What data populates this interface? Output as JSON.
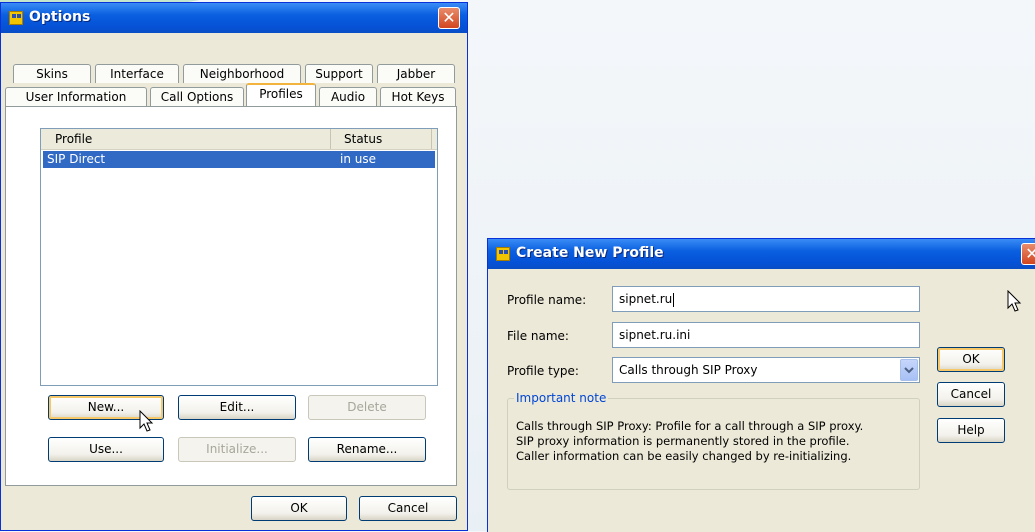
{
  "options_dialog": {
    "title": "Options",
    "tabs_row1": [
      "Skins",
      "Interface",
      "Neighborhood",
      "Support",
      "Jabber"
    ],
    "tabs_row2": [
      "User Information",
      "Call Options",
      "Profiles",
      "Audio",
      "Hot Keys"
    ],
    "active_tab": "Profiles",
    "table": {
      "columns": [
        "Profile",
        "Status"
      ],
      "rows": [
        {
          "profile": "SIP Direct",
          "status": "in use"
        }
      ]
    },
    "buttons": {
      "new": "New...",
      "edit": "Edit...",
      "delete": "Delete",
      "use": "Use...",
      "initialize": "Initialize...",
      "rename": "Rename...",
      "ok": "OK",
      "cancel": "Cancel"
    }
  },
  "create_dialog": {
    "title": "Create New Profile",
    "fields": {
      "profile_name_label": "Profile name:",
      "profile_name_value": "sipnet.ru",
      "file_name_label": "File name:",
      "file_name_value": "sipnet.ru.ini",
      "profile_type_label": "Profile type:",
      "profile_type_value": "Calls through SIP Proxy"
    },
    "note": {
      "legend": "Important note",
      "lines": [
        "Calls through SIP Proxy: Profile for a call through a SIP proxy.",
        "SIP proxy information is permanently stored in the profile.",
        "Caller information can be easily changed by re-initializing."
      ]
    },
    "buttons": {
      "ok": "OK",
      "cancel": "Cancel",
      "help": "Help"
    }
  },
  "colors": {
    "titlebar": "#0551d6",
    "selection": "#316ac5",
    "dialog_bg": "#ece9d8",
    "legend_text": "#0046d5",
    "close_button": "#d2461f"
  }
}
